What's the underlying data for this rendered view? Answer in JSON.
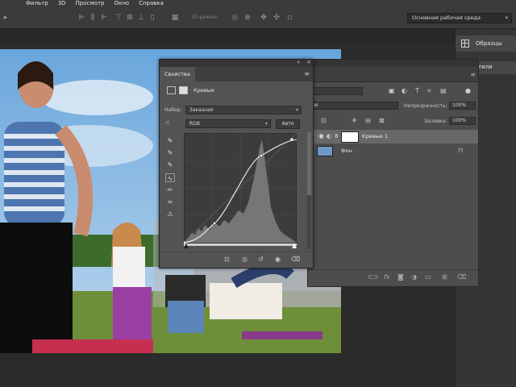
{
  "menu": [
    "Фильтр",
    "3D",
    "Просмотр",
    "Окно",
    "Справка"
  ],
  "options_bar": {
    "mode_3d_label": "3D-режим:",
    "workspace": "Основная рабочая среда"
  },
  "right_column": {
    "samples_label": "Образцы",
    "styles_label": "тили"
  },
  "properties": {
    "tab_label": "Свойства",
    "panel_title": "Кривые",
    "preset_label": "Набор:",
    "preset_value": "Заказная",
    "channel_value": "RGB",
    "auto_button": "Авто"
  },
  "layers": {
    "blend_mode_partial": "а",
    "filter_partial": "ые",
    "opacity_label": "Непрозрачность:",
    "opacity_value": "100%",
    "fill_label": "Заливка:",
    "fill_value": "100%",
    "items": [
      {
        "name": "Кривые 1",
        "selected": true
      },
      {
        "name": "Фон",
        "selected": false,
        "locked": true
      }
    ]
  },
  "colors": {
    "app_bg": "#282828",
    "panel_bg": "#535353",
    "selected_layer": "#686868"
  }
}
